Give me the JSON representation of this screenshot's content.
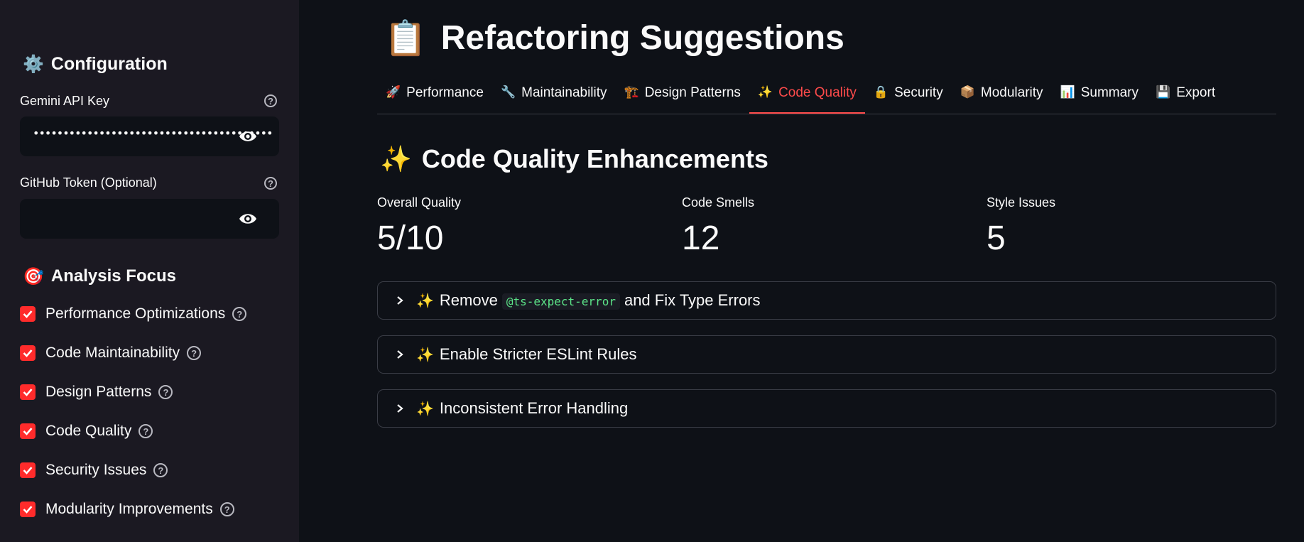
{
  "sidebar": {
    "config_icon": "⚙️",
    "config_title": "Configuration",
    "gemini_label": "Gemini API Key",
    "gemini_value": "••••••••••••••••••••••••••••••••••••••••",
    "github_label": "GitHub Token (Optional)",
    "github_value": "",
    "focus_icon": "🎯",
    "focus_title": "Analysis Focus",
    "checks": [
      {
        "label": "Performance Optimizations",
        "checked": true
      },
      {
        "label": "Code Maintainability",
        "checked": true
      },
      {
        "label": "Design Patterns",
        "checked": true
      },
      {
        "label": "Code Quality",
        "checked": true
      },
      {
        "label": "Security Issues",
        "checked": true
      },
      {
        "label": "Modularity Improvements",
        "checked": true
      }
    ]
  },
  "main": {
    "title_icon": "📋",
    "title": "Refactoring Suggestions",
    "tabs": [
      {
        "icon": "🚀",
        "label": "Performance"
      },
      {
        "icon": "🔧",
        "label": "Maintainability"
      },
      {
        "icon": "🏗️",
        "label": "Design Patterns"
      },
      {
        "icon": "✨",
        "label": "Code Quality",
        "active": true
      },
      {
        "icon": "🔒",
        "label": "Security"
      },
      {
        "icon": "📦",
        "label": "Modularity"
      },
      {
        "icon": "📊",
        "label": "Summary"
      },
      {
        "icon": "💾",
        "label": "Export"
      }
    ],
    "section_icon": "✨",
    "section_title": "Code Quality Enhancements",
    "metrics": [
      {
        "label": "Overall Quality",
        "value": "5/10"
      },
      {
        "label": "Code Smells",
        "value": "12"
      },
      {
        "label": "Style Issues",
        "value": "5"
      }
    ],
    "expanders": [
      {
        "icon": "✨",
        "pre": "Remove",
        "code": "@ts-expect-error",
        "post": "and Fix Type Errors"
      },
      {
        "icon": "✨",
        "pre": "Enable Stricter ESLint Rules"
      },
      {
        "icon": "✨",
        "pre": "Inconsistent Error Handling"
      }
    ]
  },
  "colors": {
    "accent": "#ff4b4b",
    "background": "#0e1117",
    "sidebar": "#1b1922",
    "code": "#5ce488"
  }
}
